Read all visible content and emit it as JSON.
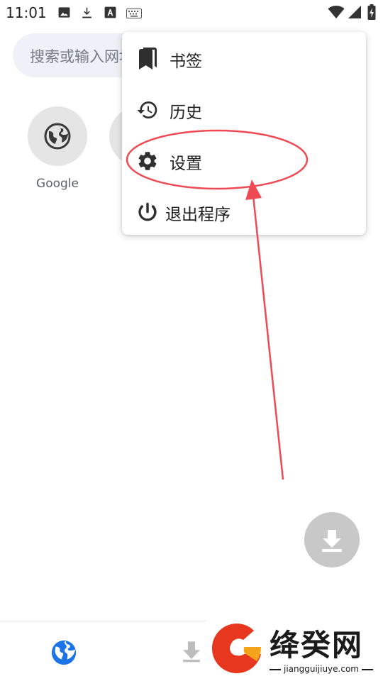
{
  "status_bar": {
    "time": "11:01",
    "left_icons": [
      "image-icon",
      "download-icon",
      "font-icon",
      "keyboard-icon"
    ],
    "right_icons": [
      "wifi-icon",
      "signal-icon",
      "battery-charging-icon"
    ]
  },
  "search": {
    "placeholder": "搜索或输入网址"
  },
  "shortcuts": [
    {
      "label": "Google",
      "icon": "globe-icon"
    },
    {
      "label": "",
      "icon": ""
    }
  ],
  "menu": {
    "items": [
      {
        "label": "书签",
        "icon": "bookmarks-icon"
      },
      {
        "label": "历史",
        "icon": "history-icon"
      },
      {
        "label": "设置",
        "icon": "settings-gear-icon"
      },
      {
        "label": "退出程序",
        "icon": "power-icon"
      }
    ]
  },
  "annotation": {
    "color": "#ef4a54",
    "shapes": [
      "highlight-ellipse",
      "pointer-arrow"
    ]
  },
  "fab": {
    "icon": "download-icon"
  },
  "bottom_nav": {
    "items": [
      {
        "icon": "globe-icon",
        "active": true
      },
      {
        "icon": "download-icon",
        "active": false
      }
    ]
  },
  "watermark": {
    "title": "绛癸网",
    "url": "jiangguijiuye.com",
    "logo": "watermark-logo"
  },
  "colors": {
    "accent": "#1a73e8",
    "menu_text": "#222222",
    "icon_dark": "#333333",
    "fab_bg": "#c8c8c8",
    "search_bg": "#eef1f7",
    "annotation_red": "#ef4a54"
  }
}
